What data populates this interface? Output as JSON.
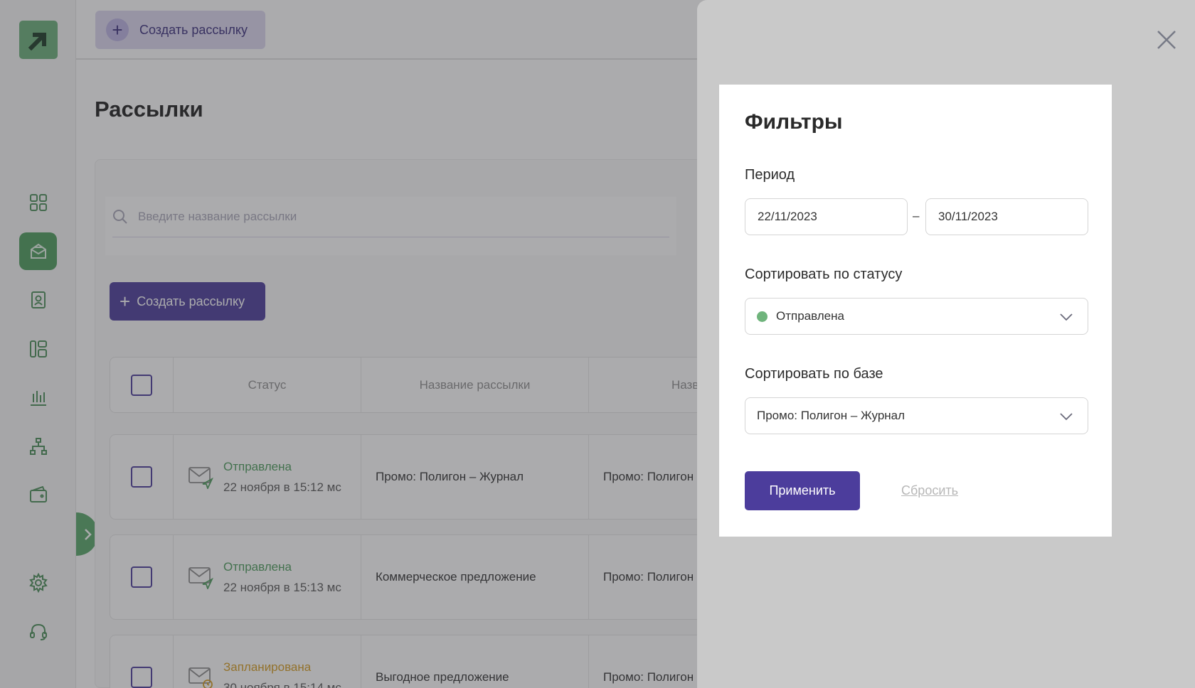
{
  "topbar": {
    "create_label": "Создать рассылку"
  },
  "page": {
    "title": "Рассылки"
  },
  "search": {
    "placeholder": "Введите название рассылки"
  },
  "toolbar": {
    "create_label": "Создать рассылку"
  },
  "table": {
    "columns": [
      "Статус",
      "Название рассылки",
      "Назв"
    ],
    "rows": [
      {
        "status": "Отправлена",
        "status_kind": "sent",
        "date": "22 ноября в 15:12 мс",
        "name": "Промо: Полигон – Журнал",
        "base": "Промо: Полигон"
      },
      {
        "status": "Отправлена",
        "status_kind": "sent",
        "date": "22 ноября в 15:13 мс",
        "name": "Коммерческое предложение",
        "base": "Промо: Полигон"
      },
      {
        "status": "Запланирована",
        "status_kind": "planned",
        "date": "30 ноября в 15:14 мс",
        "name": "Выгодное предложение",
        "base": "Промо: Полигон"
      }
    ]
  },
  "filters": {
    "title": "Фильтры",
    "period_label": "Период",
    "date_from": "22/11/2023",
    "date_separator": "–",
    "date_to": "30/11/2023",
    "status_label": "Сортировать по статусу",
    "status_value": "Отправлена",
    "base_label": "Сортировать по базе",
    "base_value": "Промо: Полигон – Журнал",
    "apply_label": "Применить",
    "reset_label": "Сбросить"
  },
  "colors": {
    "primary": "#4c3d9c",
    "green": "#6fb47c",
    "planned": "#d69d22"
  }
}
